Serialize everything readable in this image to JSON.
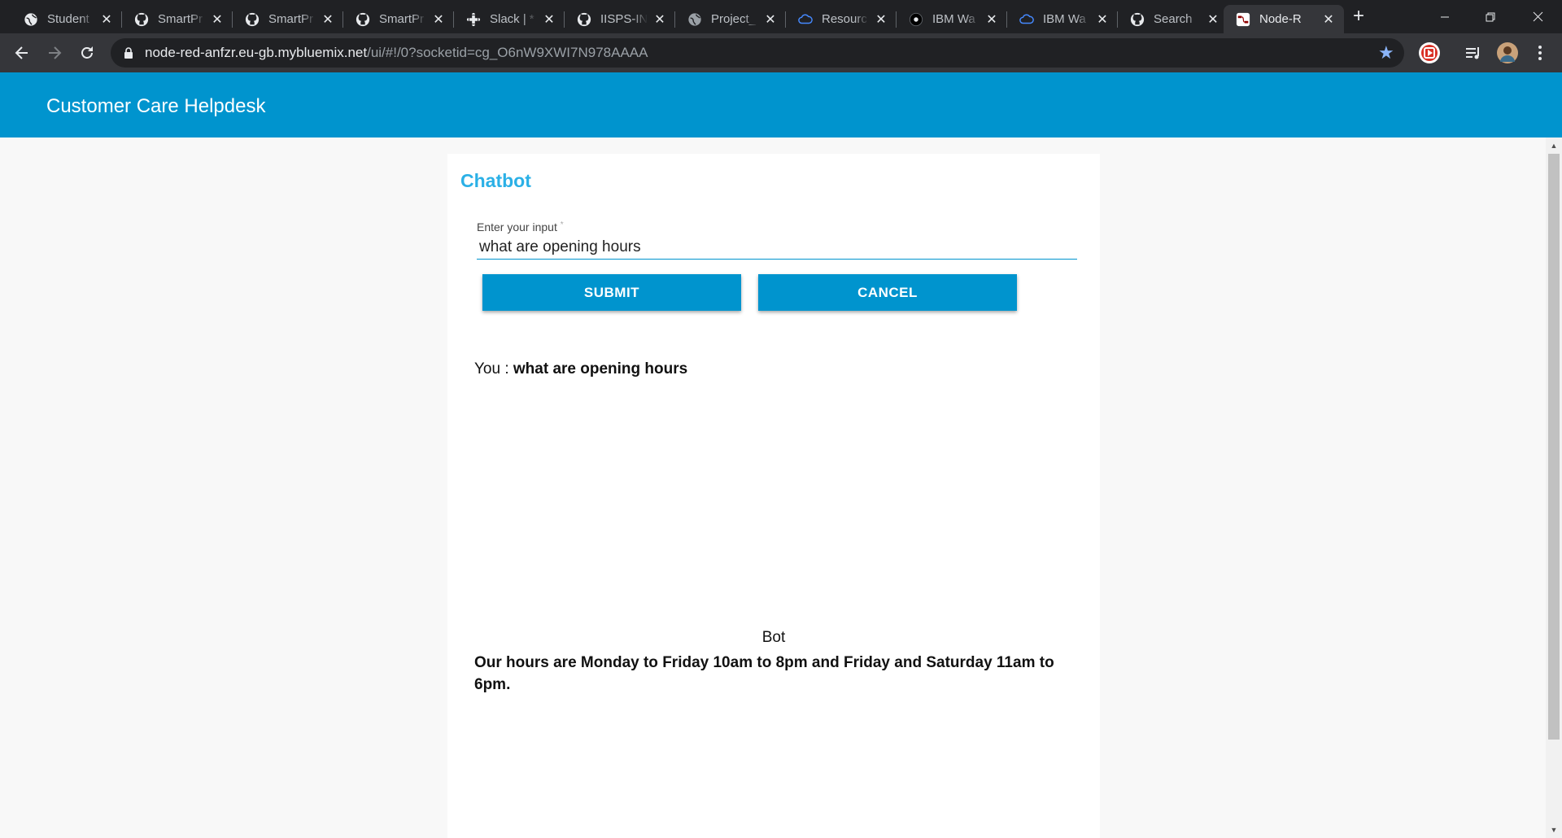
{
  "browser": {
    "tabs": [
      {
        "title": "Student",
        "icon": "globe-icon",
        "icon_color": "#e8eaed"
      },
      {
        "title": "SmartPr",
        "icon": "github-icon",
        "icon_color": "#e8eaed"
      },
      {
        "title": "SmartPr",
        "icon": "github-icon",
        "icon_color": "#e8eaed"
      },
      {
        "title": "SmartPr",
        "icon": "github-icon",
        "icon_color": "#e8eaed"
      },
      {
        "title": "Slack | *",
        "icon": "slack-icon",
        "icon_color": "#e8eaed"
      },
      {
        "title": "IISPS-IN",
        "icon": "github-icon",
        "icon_color": "#e8eaed"
      },
      {
        "title": "Project_",
        "icon": "globe-icon",
        "icon_color": "#9aa0a6"
      },
      {
        "title": "Resourc",
        "icon": "ibm-cloud-icon",
        "icon_color": "#4589ff"
      },
      {
        "title": "IBM Wa",
        "icon": "watson-icon",
        "icon_color": "#000000"
      },
      {
        "title": "IBM Wa",
        "icon": "ibm-cloud-icon",
        "icon_color": "#4589ff"
      },
      {
        "title": "Search",
        "icon": "github-icon",
        "icon_color": "#e8eaed"
      },
      {
        "title": "Node-R",
        "icon": "node-red-icon",
        "icon_color": "#8f0000"
      }
    ],
    "active_tab_index": 11,
    "url_host": "node-red-anfzr.eu-gb.mybluemix.net",
    "url_path": "/ui/#!/0?socketid=cg_O6nW9XWI7N978AAAA"
  },
  "app": {
    "title": "Customer Care Helpdesk",
    "header_color": "#0094ce"
  },
  "chat": {
    "title": "Chatbot",
    "input_label": "Enter your input",
    "required_mark": "*",
    "input_value": "what are opening hours",
    "submit_label": "SUBMIT",
    "cancel_label": "CANCEL",
    "user_prefix": "You : ",
    "user_message": "what are opening hours",
    "bot_label": "Bot",
    "bot_message": "Our hours are Monday to Friday 10am to 8pm and Friday and Saturday 11am to 6pm."
  }
}
